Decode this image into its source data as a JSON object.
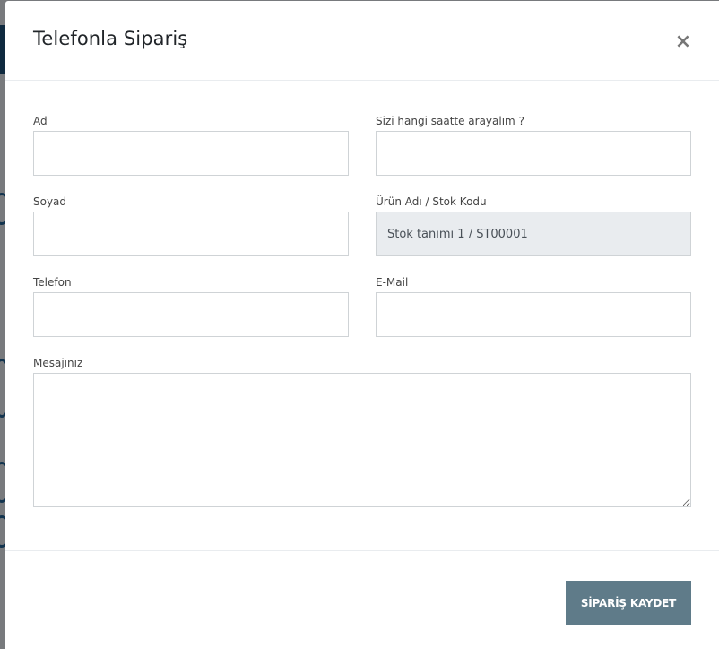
{
  "modal": {
    "title": "Telefonla Sipariş",
    "close_label": "×"
  },
  "form": {
    "first_name": {
      "label": "Ad",
      "value": ""
    },
    "call_time": {
      "label": "Sizi hangi saatte arayalım ?",
      "value": ""
    },
    "last_name": {
      "label": "Soyad",
      "value": ""
    },
    "product": {
      "label": "Ürün Adı / Stok Kodu",
      "value": "Stok tanımı 1 / ST00001"
    },
    "phone": {
      "label": "Telefon",
      "value": ""
    },
    "email": {
      "label": "E-Mail",
      "value": ""
    },
    "message": {
      "label": "Mesajınız",
      "value": ""
    }
  },
  "footer": {
    "submit_label": "SİPARİŞ KAYDET"
  },
  "colors": {
    "submit_bg": "#5f7b89",
    "readonly_bg": "#e9ecef",
    "border": "#cfd3d6"
  }
}
